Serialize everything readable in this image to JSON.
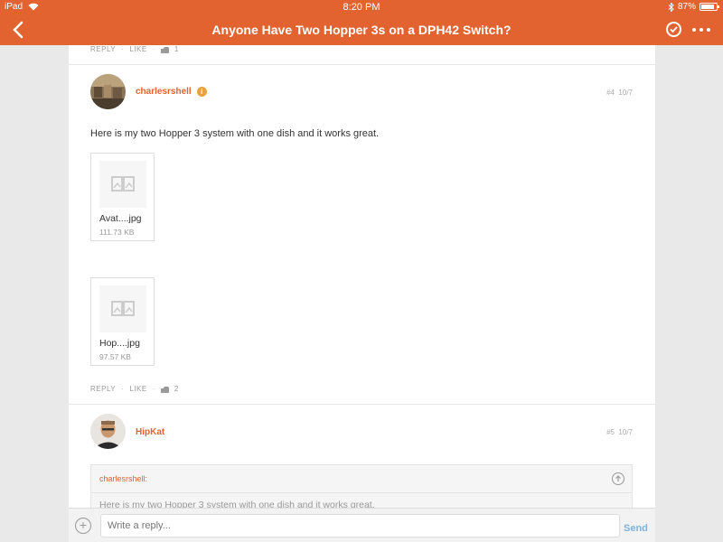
{
  "status_bar": {
    "device": "iPad",
    "time": "8:20 PM",
    "battery": "87%"
  },
  "header": {
    "title": "Anyone Have Two Hopper 3s on a DPH42 Switch?"
  },
  "previous_post": {
    "reply_label": "REPLY",
    "like_label": "LIKE",
    "likes": "1"
  },
  "post4": {
    "username": "charlesrshell",
    "badge": "i",
    "number": "#4",
    "date": "10/7",
    "text": "Here is my two Hopper 3 system with one dish and it works great.",
    "attachments": [
      {
        "name": "Avat....jpg",
        "size": "111.73 KB"
      },
      {
        "name": "Hop....jpg",
        "size": "97.57 KB"
      }
    ],
    "reply_label": "REPLY",
    "like_label": "LIKE",
    "likes": "2"
  },
  "post5": {
    "username": "HipKat",
    "number": "#5",
    "date": "10/7",
    "quote_author": "charlesrshell:",
    "quote_text": "Here is my two Hopper 3 system with one dish and it works great."
  },
  "reply_bar": {
    "placeholder": "Write a reply...",
    "send_label": "Send"
  }
}
